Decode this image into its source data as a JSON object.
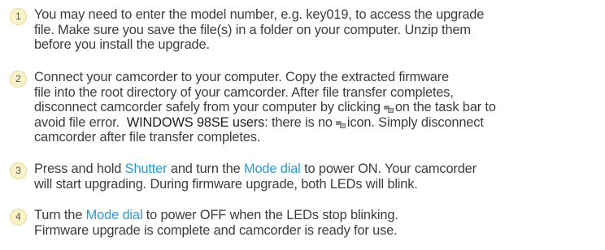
{
  "steps": [
    {
      "number": "1",
      "lines": [
        "You may need to enter the model number, e.g. key019, to access the upgrade",
        "file.  Make sure you save the file(s) in a folder on your computer.  Unzip them",
        "before you install the upgrade."
      ]
    },
    {
      "number": "2",
      "line1": "Connect your camcorder to your computer.  Copy the extracted firmware",
      "line2": "file into the root directory of your camcorder.  After file transfer completes,",
      "line3": "disconnect camcorder safely from your computer by clicking",
      "line4_pre": "on the task bar to",
      "line4_a": "avoid file error.",
      "line4_strong": "WINDOWS 98SE users",
      "line4_b": ": there is no",
      "line4_c": "icon. Simply disconnect",
      "line5": "camcorder after file transfer completes.",
      "icon": "safely-remove-hardware-icon"
    },
    {
      "number": "3",
      "line1_a": "Press and hold",
      "line1_shutter": "Shutter",
      "line1_b": "and turn the",
      "line1_mode": "Mode dial",
      "line1_c": "to power ON. Your camcorder",
      "line2": "will start upgrading.  During firmware upgrade, both LEDs will blink."
    },
    {
      "number": "4",
      "line1_a": "Turn the",
      "line1_mode": "Mode dial",
      "line1_b": "to power OFF when the LEDs stop blinking.",
      "line2": "Firmware upgrade is complete and camcorder is ready for use."
    }
  ],
  "colors": {
    "text": "#3d3d3d",
    "highlight": "#2b9bd6",
    "number_circle": "#fbf3c8"
  }
}
